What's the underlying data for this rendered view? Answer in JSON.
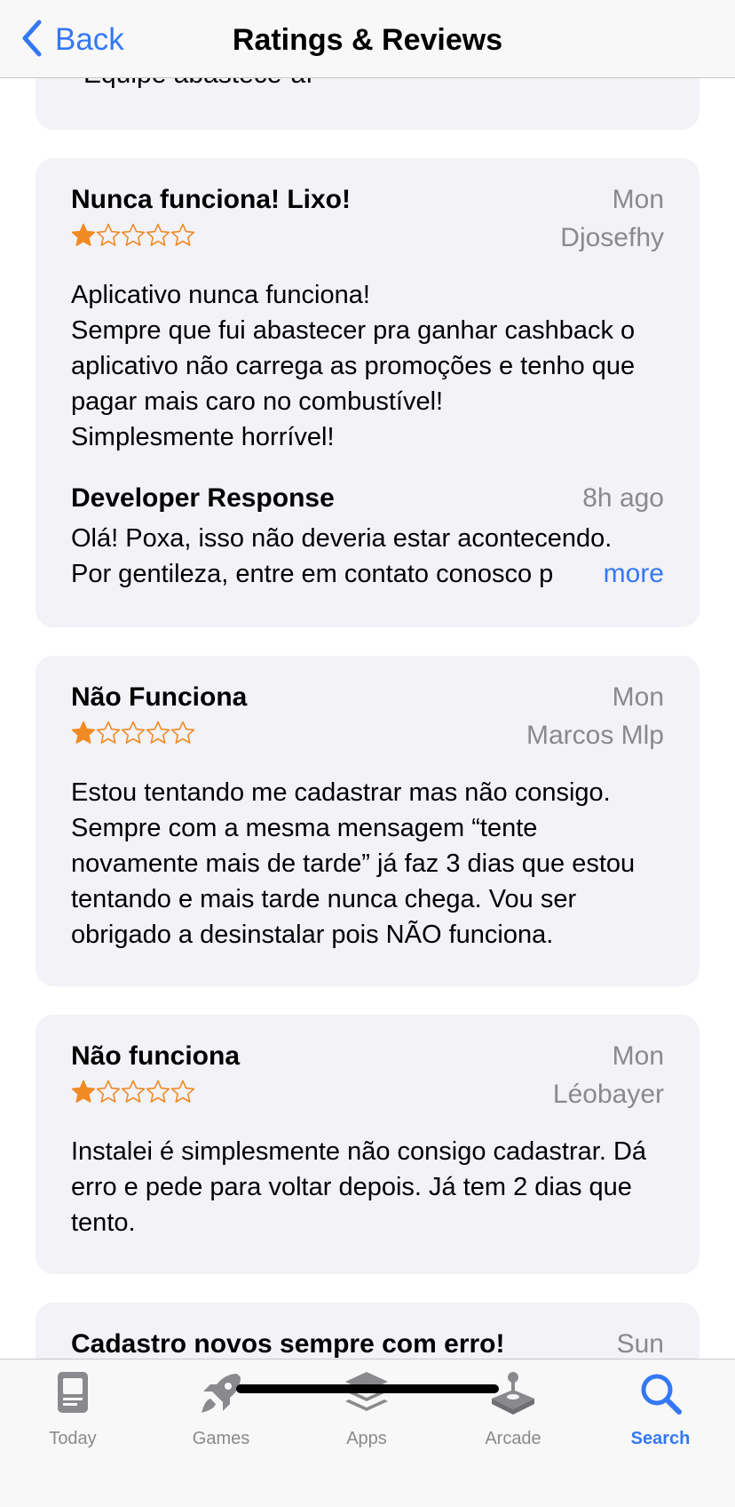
{
  "nav": {
    "back_label": "Back",
    "title": "Ratings & Reviews"
  },
  "previous_card": {
    "text": "“Equipe abastece-aí”"
  },
  "reviews": [
    {
      "title": "Nunca funciona! Lixo!",
      "date": "Mon",
      "author": "Djosefhy",
      "rating": 1,
      "rating_max": 5,
      "body": "Aplicativo nunca funciona!\nSempre que fui abastecer pra ganhar cashback o aplicativo não carrega as promoções e tenho que pagar mais caro no combustível!\nSimplesmente horrível!",
      "developer_response": {
        "label": "Developer Response",
        "time": "8h ago",
        "body": "Olá! Poxa, isso não deveria estar acontecendo.\nPor gentileza, entre em contato conosco p",
        "more_label": "more"
      }
    },
    {
      "title": "Não Funciona",
      "date": "Mon",
      "author": "Marcos Mlp",
      "rating": 1,
      "rating_max": 5,
      "body": "Estou tentando me cadastrar mas não consigo. Sempre com a mesma mensagem “tente novamente mais de tarde” já faz 3 dias que estou tentando e mais tarde nunca chega. Vou ser obrigado a desinstalar pois NÃO funciona."
    },
    {
      "title": "Não funciona",
      "date": "Mon",
      "author": "Léobayer",
      "rating": 1,
      "rating_max": 5,
      "body": "Instalei é simplesmente não consigo cadastrar. Dá erro e pede para voltar depois. Já tem 2 dias que tento."
    },
    {
      "title": "Cadastro novos sempre com erro!",
      "date": "Sun"
    }
  ],
  "tabbar": {
    "tabs": [
      {
        "label": "Today",
        "icon": "today-icon",
        "active": false
      },
      {
        "label": "Games",
        "icon": "rocket-icon",
        "active": false
      },
      {
        "label": "Apps",
        "icon": "apps-stack-icon",
        "active": false
      },
      {
        "label": "Arcade",
        "icon": "joystick-icon",
        "active": false
      },
      {
        "label": "Search",
        "icon": "search-icon",
        "active": true
      }
    ]
  },
  "colors": {
    "accent": "#3478f6",
    "star": "#f08a24",
    "card_background": "#f2f2f7",
    "secondary_text": "#8a8a8e"
  }
}
